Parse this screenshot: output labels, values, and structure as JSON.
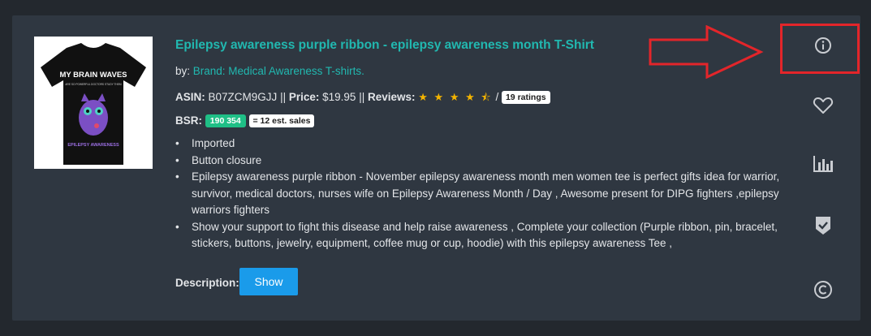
{
  "product": {
    "title": "Epilepsy awareness purple ribbon - epilepsy awareness month T-Shirt",
    "by_label": "by:",
    "brand": "Brand: Medical Awareness T-shirts.",
    "asin_label": "ASIN:",
    "asin": "B07ZCM9GJJ",
    "sep1": "||",
    "price_label": "Price:",
    "price": "$19.95",
    "sep2": "||",
    "reviews_label": "Reviews:",
    "rating": 4.5,
    "stars_text": "★ ★ ★ ★ ⯪",
    "ratings_sep": "/",
    "ratings_count": "19 ratings",
    "bsr_label": "BSR:",
    "bsr": "190 354",
    "est_sales": "= 12 est. sales",
    "bullets": [
      "Imported",
      "Button closure",
      "Epilepsy awareness purple ribbon - November epilepsy awareness month men women tee is perfect gifts idea for warrior, survivor, medical doctors, nurses wife on Epilepsy Awareness Month / Day , Awesome present for DIPG fighters ,epilepsy warriors fighters",
      "Show your support to fight this disease and help raise awareness , Complete your collection (Purple ribbon, pin, bracelet, stickers, buttons, jewelry, equipment, coffee mug or cup, hoodie) with this epilepsy awareness Tee ,"
    ],
    "description_label": "Description:",
    "show_button": "Show"
  },
  "shirt_image": {
    "line1": "MY BRAIN WAVES",
    "line2": "ARE SO POWERFUL DOCTORS STUDY THEM",
    "line3": "EPILEPSY AWARENESS"
  },
  "sidebar_icons": [
    "info-icon",
    "heart-icon",
    "bar-chart-icon",
    "shield-check-icon",
    "copyright-icon"
  ],
  "colors": {
    "background": "#23282e",
    "card": "#2f3741",
    "accent_teal": "#21b8b0",
    "bsr_green": "#1fbf86",
    "button_blue": "#1a9bea",
    "star": "#f4b400",
    "annotation_red": "#e3252a"
  }
}
